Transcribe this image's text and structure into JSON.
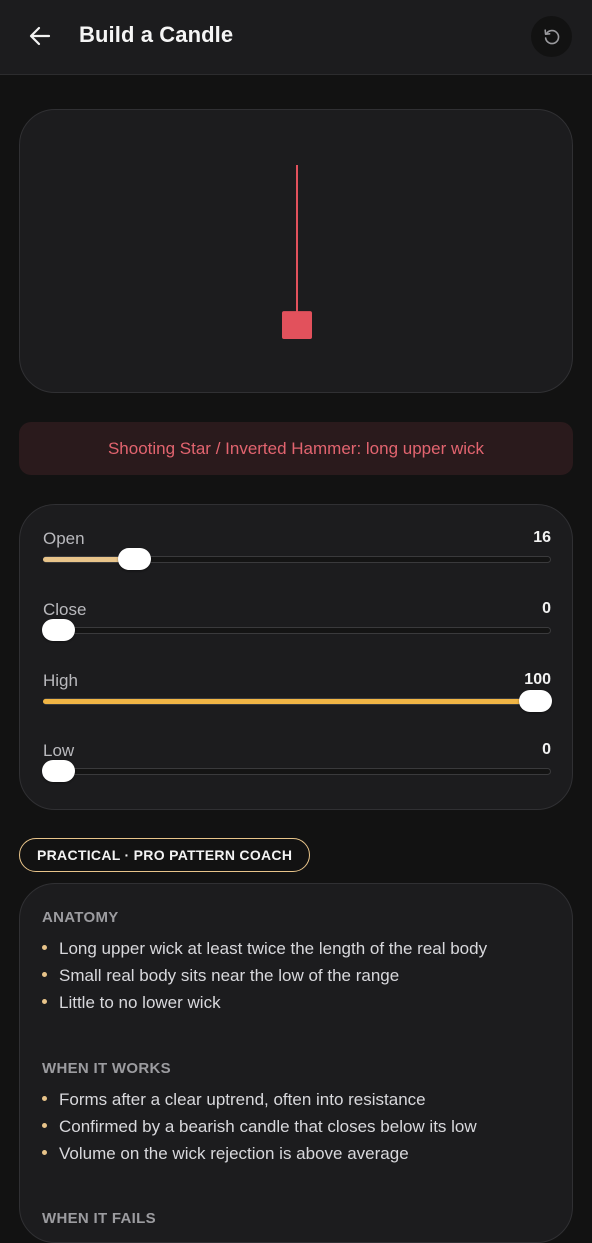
{
  "header": {
    "title": "Build a Candle",
    "back_icon": "arrow-left-icon",
    "reset_icon": "reset-icon"
  },
  "candle": {
    "open": 16,
    "close": 0,
    "high": 100,
    "low": 0,
    "color": "#e2515c"
  },
  "pattern": {
    "text": "Shooting Star / Inverted Hammer: long upper wick"
  },
  "sliders": [
    {
      "label": "Open",
      "value": "16",
      "fraction": 0.16,
      "fill_color": "#e8c48a"
    },
    {
      "label": "Close",
      "value": "0",
      "fraction": 0.0,
      "fill_color": "#e8c48a"
    },
    {
      "label": "High",
      "value": "100",
      "fraction": 1.0,
      "fill_color": "#f0b545"
    },
    {
      "label": "Low",
      "value": "0",
      "fraction": 0.0,
      "fill_color": "#e8c48a"
    }
  ],
  "coach": {
    "badge": "PRACTICAL · PRO PATTERN COACH",
    "sections": [
      {
        "title": "ANATOMY",
        "items": [
          "Long upper wick at least twice the length of the real body",
          "Small real body sits near the low of the range",
          "Little to no lower wick"
        ]
      },
      {
        "title": "WHEN IT WORKS",
        "items": [
          "Forms after a clear uptrend, often into resistance",
          "Confirmed by a bearish candle that closes below its low",
          "Volume on the wick rejection is above average"
        ]
      },
      {
        "title": "WHEN IT FAILS",
        "items": []
      }
    ]
  },
  "colors": {
    "accent": "#e8c48a",
    "bearish": "#e2515c",
    "background": "#121212",
    "card": "#1c1c1e"
  }
}
